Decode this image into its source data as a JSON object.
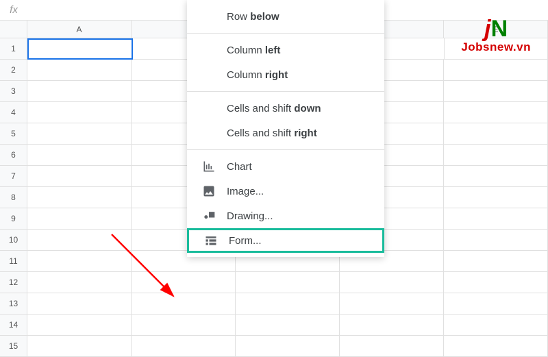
{
  "fx_label": "fx",
  "columns": [
    "A",
    "",
    "",
    "",
    "E"
  ],
  "rows": [
    "1",
    "2",
    "3",
    "4",
    "5",
    "6",
    "7",
    "8",
    "9",
    "10",
    "11",
    "12",
    "13",
    "14",
    "15"
  ],
  "selected_cell": {
    "row": 0,
    "col": 0
  },
  "menu": {
    "groups": [
      [
        {
          "label_prefix": "Row ",
          "label_bold": "below",
          "icon": null
        }
      ],
      [
        {
          "label_prefix": "Column ",
          "label_bold": "left",
          "icon": null
        },
        {
          "label_prefix": "Column ",
          "label_bold": "right",
          "icon": null
        }
      ],
      [
        {
          "label_prefix": "Cells and shift ",
          "label_bold": "down",
          "icon": null
        },
        {
          "label_prefix": "Cells and shift ",
          "label_bold": "right",
          "icon": null
        }
      ],
      [
        {
          "label_prefix": "Chart",
          "label_bold": "",
          "icon": "chart"
        },
        {
          "label_prefix": "Image...",
          "label_bold": "",
          "icon": "image"
        },
        {
          "label_prefix": "Drawing...",
          "label_bold": "",
          "icon": "drawing"
        },
        {
          "label_prefix": "Form...",
          "label_bold": "",
          "icon": "form",
          "highlighted": true
        }
      ]
    ]
  },
  "watermark": {
    "logo_j": "j",
    "logo_n": "N",
    "text": "Jobsnew.vn"
  }
}
